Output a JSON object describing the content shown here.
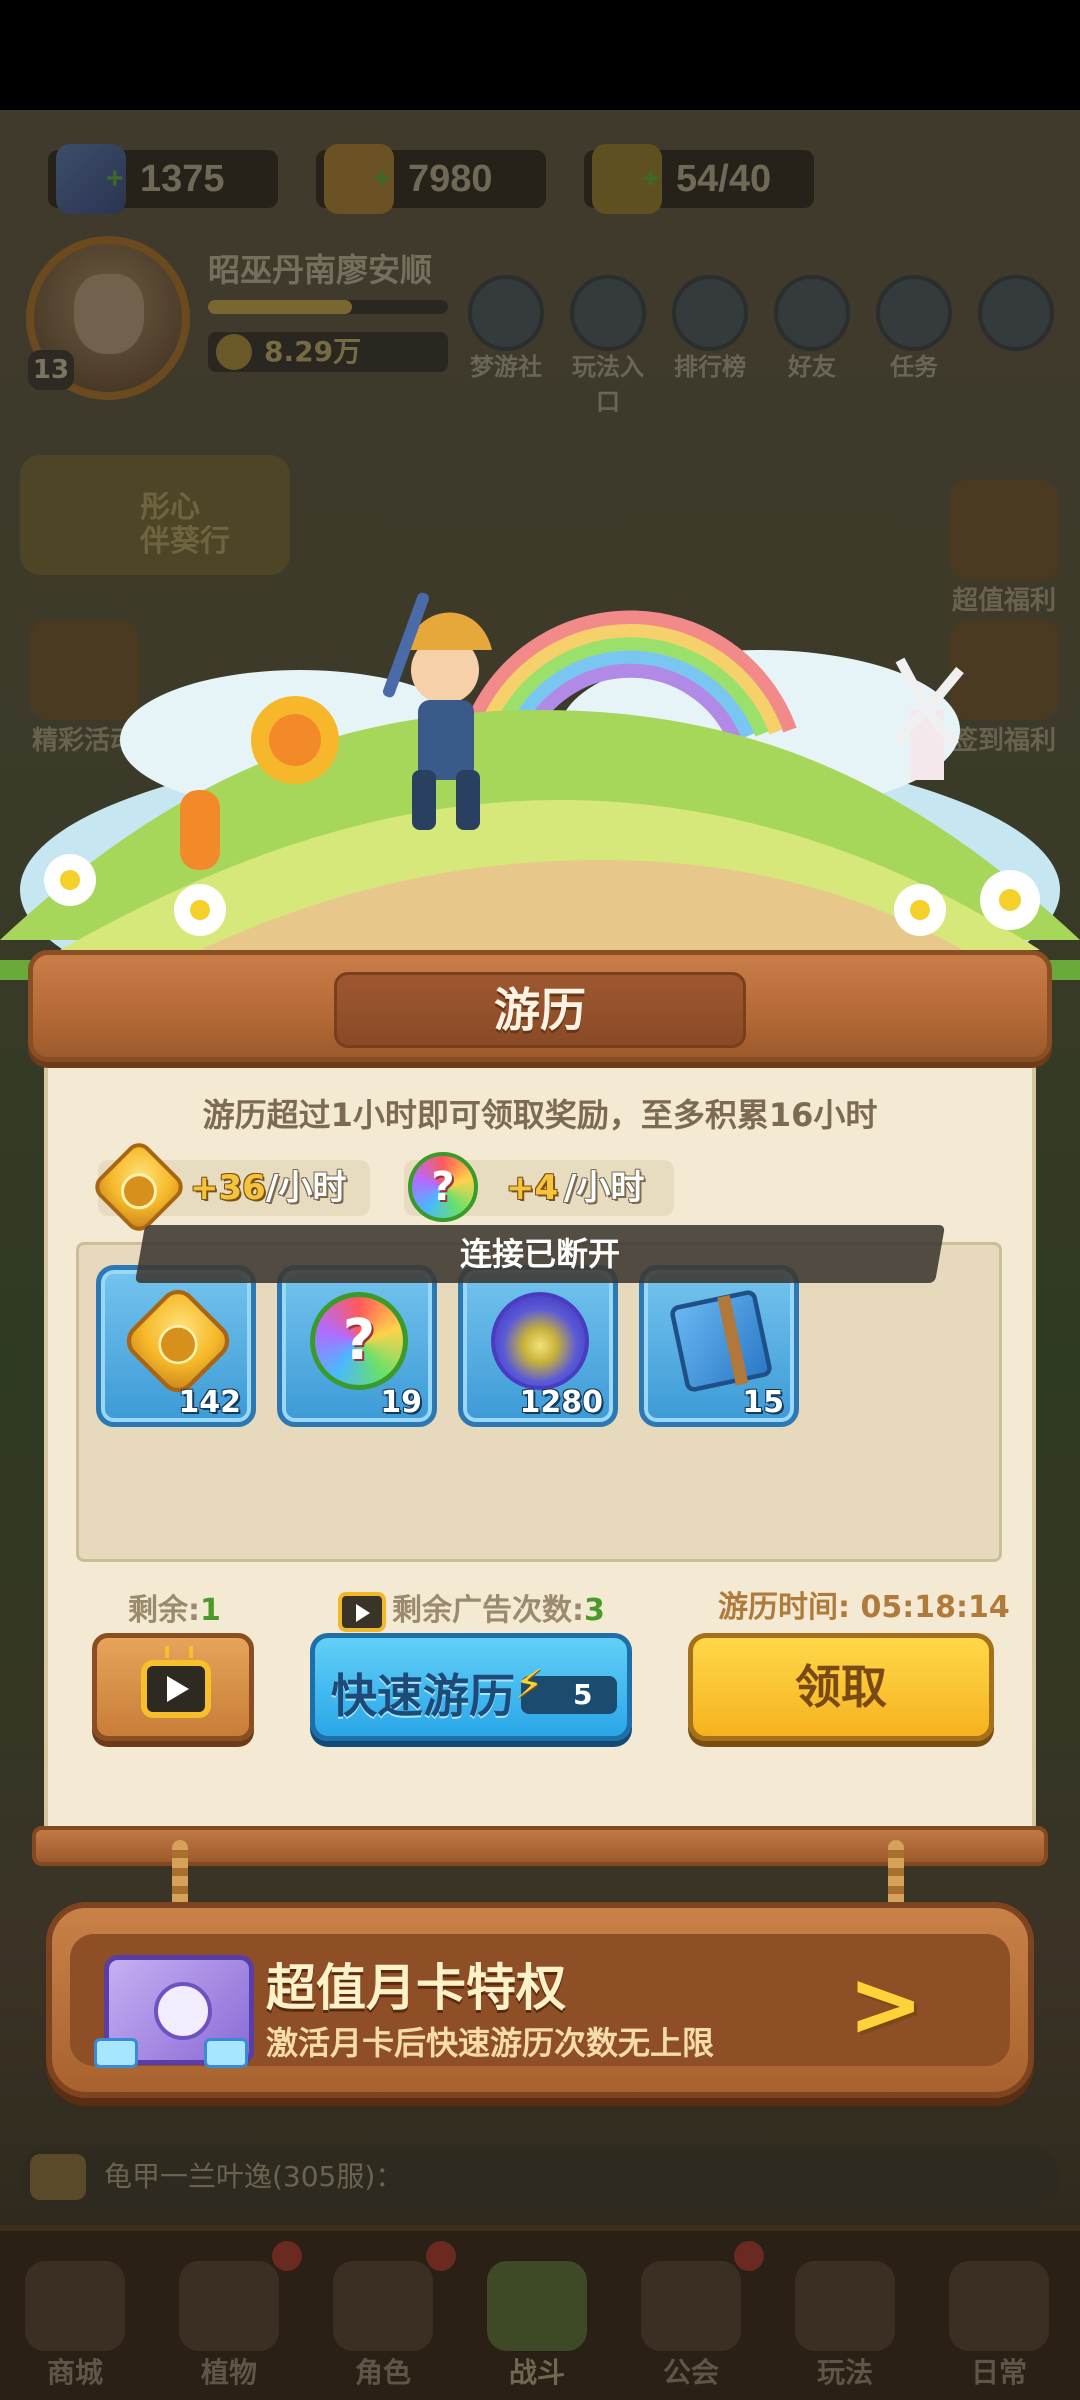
{
  "top_resources": {
    "gems": "1375",
    "coins": "7980",
    "energy": "54/40"
  },
  "player": {
    "name": "昭巫丹南廖安顺",
    "level": "13",
    "power": "8.29万",
    "xp_fraction": 0.6
  },
  "top_nav": [
    {
      "label": "梦游社",
      "icon": "dream-club-icon"
    },
    {
      "label": "玩法入口",
      "icon": "gamepad-icon"
    },
    {
      "label": "排行榜",
      "icon": "leaderboard-icon"
    },
    {
      "label": "好友",
      "icon": "friends-icon"
    },
    {
      "label": "任务",
      "icon": "tasks-icon"
    }
  ],
  "side_left": {
    "promo_label_1": "彤心",
    "promo_label_2": "伴葵行",
    "events_label": "精彩活动"
  },
  "side_right": {
    "value_benefits": "超值福利",
    "checkin_benefits": "签到福利"
  },
  "panel": {
    "title": "游历",
    "info": "游历超过1小时即可领取奖励，至多积累16小时",
    "coin_rate": "+36",
    "seed_rate": "+4",
    "rate_unit": "/小时",
    "toast": "连接已断开",
    "rewards": [
      {
        "item": "gold-coin",
        "count": "142"
      },
      {
        "item": "mystery-seed",
        "count": "19"
      },
      {
        "item": "spirit-orb",
        "count": "1280"
      },
      {
        "item": "skill-book",
        "count": "15"
      }
    ],
    "remaining_label": "剩余:",
    "remaining_value": "1",
    "ad_remaining_label": "剩余广告次数:",
    "ad_remaining_value": "3",
    "travel_time_label": "游历时间:",
    "travel_time_value": "05:18:14",
    "quick_travel_label": "快速游历",
    "quick_travel_cost": "5",
    "claim_label": "领取"
  },
  "banner": {
    "title": "超值月卡特权",
    "subtitle": "激活月卡后快速游历次数无上限",
    "arrow": ">"
  },
  "chat": {
    "text": "龟甲一兰叶逸(305服)："
  },
  "bottom_nav": [
    {
      "label": "商城"
    },
    {
      "label": "植物"
    },
    {
      "label": "角色"
    },
    {
      "label": "战斗"
    },
    {
      "label": "公会"
    },
    {
      "label": "玩法"
    },
    {
      "label": "日常"
    }
  ],
  "colors": {
    "wood": "#b56a36",
    "parchment": "#f4ead3",
    "blue_button": "#2aa6e8",
    "yellow_button": "#f6b21e",
    "green_number": "#4a9a2a"
  }
}
